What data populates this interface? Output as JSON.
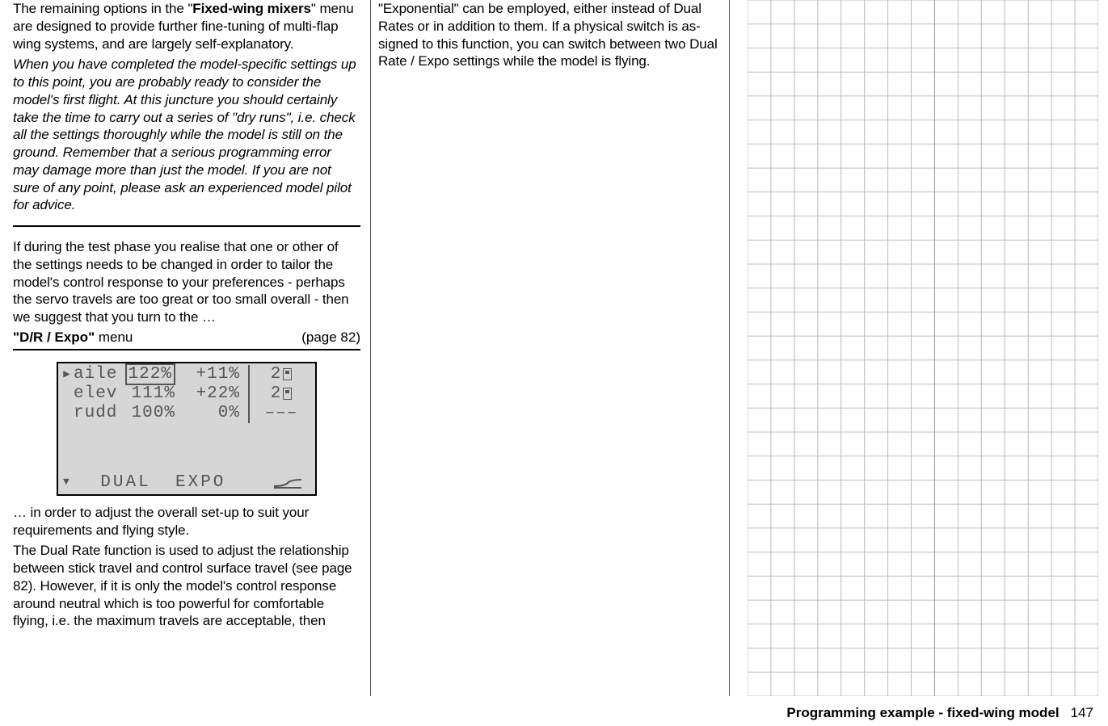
{
  "col1": {
    "p1_pre": "The remaining options in the \"",
    "p1_bold": "Fixed-wing mixers",
    "p1_post": "\" menu are designed to provide further fine-tuning of multi-flap wing systems, and are largely self-explanatory.",
    "p2_italic": "When you have completed the model-specific settings up to this point, you are probably ready to consider the model's first flight. At this juncture you should certainly take the time to carry out a series of \"dry runs\", i.e. check all the settings thoroughly while the model is still on the ground. Remember that a serious programming error may damage more than just the model. If you are not sure of any point, please ask an experienced model pilot for advice.",
    "p3": "If during the test phase you realise that one or other of the settings needs to be changed in order to tailor the model's control response to your preferences - perhaps the servo travels are too great or too small overall - then we suggest that you turn to the …",
    "menu_label_bold": "\"D/R / Expo\"",
    "menu_label_rest": " menu",
    "menu_page": "(page 82)",
    "p4": "… in order to adjust the overall set-up to suit your requirements and flying style.",
    "p5": "The Dual Rate function is used to adjust the relationship between stick travel and control surface travel (see page 82). However, if it is only the model's control response around neutral which is too powerful for comfortable flying, i.e. the maximum travels are acceptable, then"
  },
  "col2": {
    "p1": "\"Exponential\" can be employed, either instead of Dual Rates or in addition to them. If a physical switch is as-signed to this function, you can switch between two Dual Rate / Expo settings while the model is flying."
  },
  "lcd": {
    "rows": [
      {
        "marker": "▶",
        "name": "aile",
        "dual": "122%",
        "expo": "+11%",
        "sw": "2",
        "selected": true,
        "dashes": false
      },
      {
        "marker": "",
        "name": "elev",
        "dual": "111%",
        "expo": "+22%",
        "sw": "2",
        "selected": false,
        "dashes": false
      },
      {
        "marker": "",
        "name": "rudd",
        "dual": "100%",
        "expo": "0%",
        "sw": "–––",
        "selected": false,
        "dashes": true
      }
    ],
    "footer": {
      "arrow": "▼",
      "dual": "DUAL",
      "expo": "EXPO"
    }
  },
  "footer": {
    "title": "Programming example - fixed-wing model",
    "page": "147"
  }
}
